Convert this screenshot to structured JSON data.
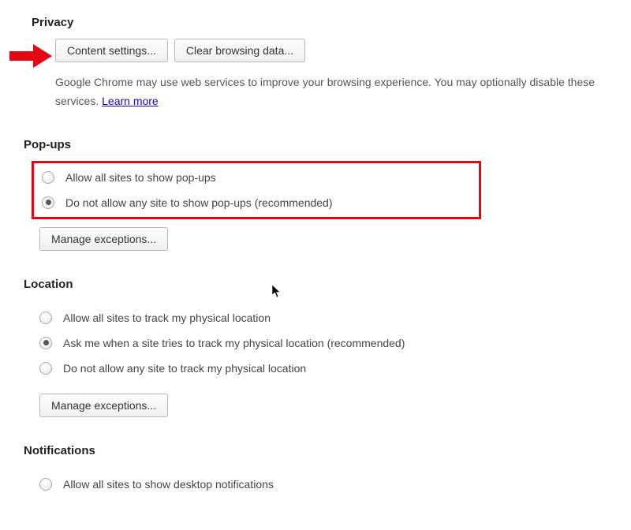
{
  "privacy": {
    "heading": "Privacy",
    "content_settings_label": "Content settings...",
    "clear_browsing_label": "Clear browsing data...",
    "description_prefix": "Google Chrome may use web services to improve your browsing experience. You may optionally disable these services. ",
    "learn_more": "Learn more"
  },
  "popups": {
    "heading": "Pop-ups",
    "option_allow": "Allow all sites to show pop-ups",
    "option_block": "Do not allow any site to show pop-ups (recommended)",
    "selected": "block",
    "manage_label": "Manage exceptions..."
  },
  "location": {
    "heading": "Location",
    "option_allow": "Allow all sites to track my physical location",
    "option_ask": "Ask me when a site tries to track my physical location (recommended)",
    "option_block": "Do not allow any site to track my physical location",
    "selected": "ask",
    "manage_label": "Manage exceptions..."
  },
  "notifications": {
    "heading": "Notifications",
    "option_allow": "Allow all sites to show desktop notifications"
  },
  "colors": {
    "highlight": "#e30613",
    "link": "#1a0dab"
  }
}
